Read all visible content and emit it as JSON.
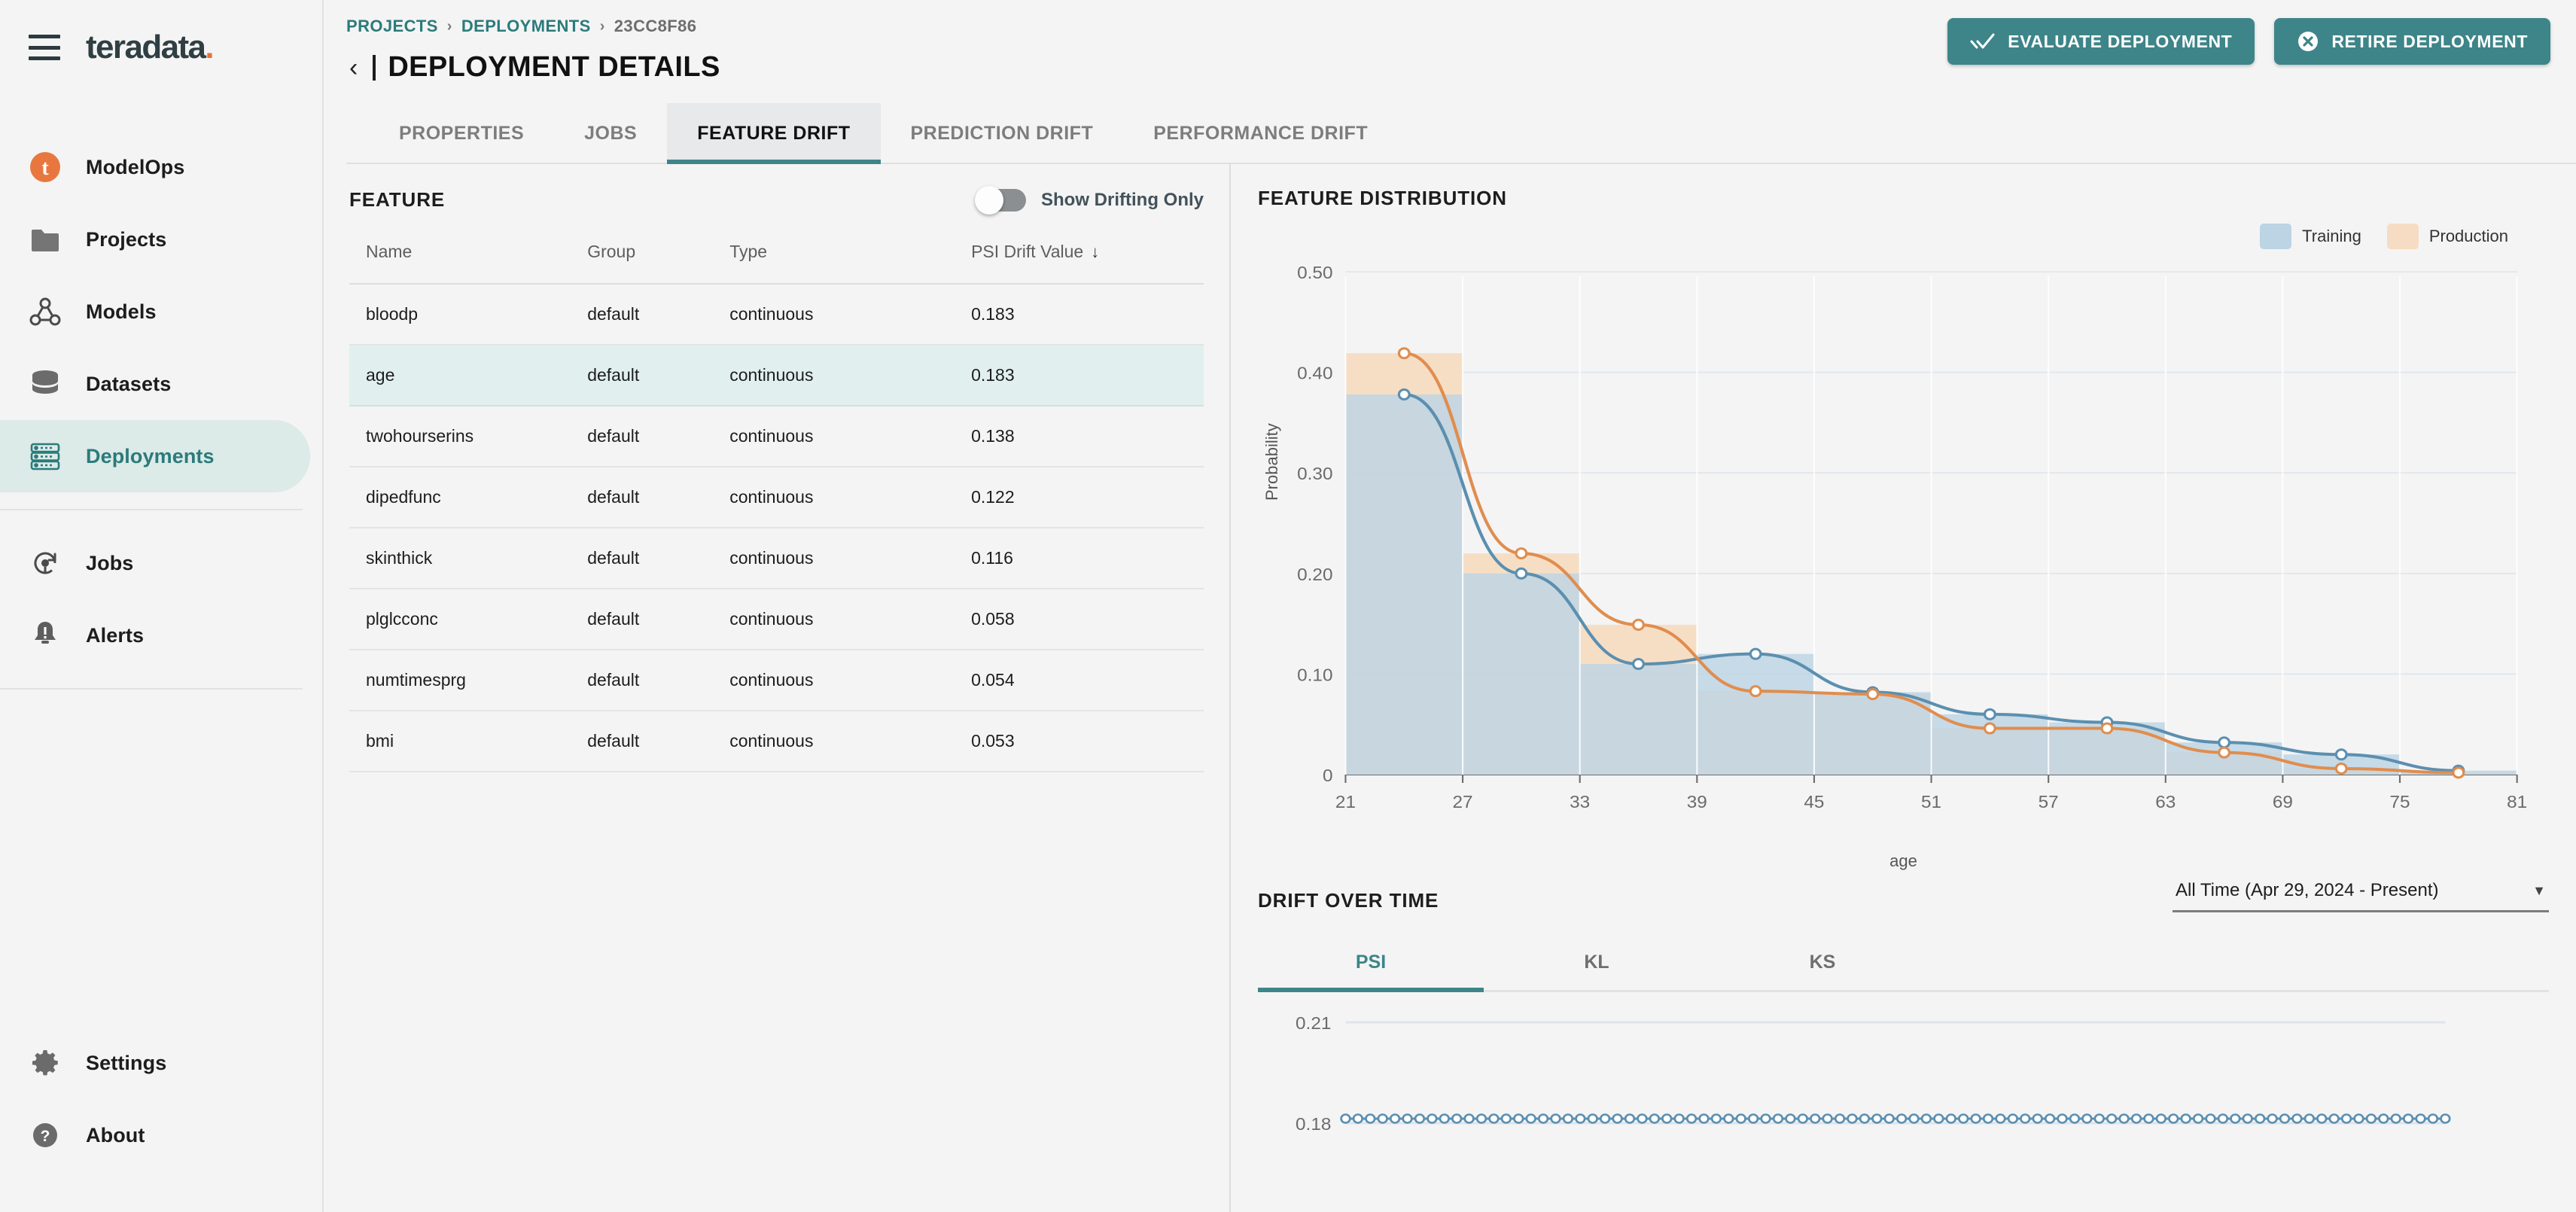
{
  "brand": {
    "name": "teradata",
    "dot": "."
  },
  "sidebar": {
    "items": [
      {
        "label": "ModelOps",
        "icon": "teradata-logo-icon"
      },
      {
        "label": "Projects",
        "icon": "folder-icon"
      },
      {
        "label": "Models",
        "icon": "model-graph-icon"
      },
      {
        "label": "Datasets",
        "icon": "database-icon"
      },
      {
        "label": "Deployments",
        "icon": "server-rack-icon"
      },
      {
        "label": "Jobs",
        "icon": "job-refresh-icon"
      },
      {
        "label": "Alerts",
        "icon": "bell-alert-icon"
      }
    ],
    "bottom_items": [
      {
        "label": "Settings",
        "icon": "gear-icon"
      },
      {
        "label": "About",
        "icon": "question-circle-icon"
      }
    ],
    "active": "Deployments"
  },
  "breadcrumb": {
    "projects": "PROJECTS",
    "deployments": "DEPLOYMENTS",
    "current": "23CC8F86",
    "sep": "›"
  },
  "header": {
    "title": "DEPLOYMENT DETAILS",
    "back_icon": "chevron-left-icon",
    "evaluate_label": "EVALUATE DEPLOYMENT",
    "retire_label": "RETIRE DEPLOYMENT",
    "accent": "#3d8589"
  },
  "tabs": [
    {
      "label": "PROPERTIES",
      "active": false
    },
    {
      "label": "JOBS",
      "active": false
    },
    {
      "label": "FEATURE DRIFT",
      "active": true
    },
    {
      "label": "PREDICTION DRIFT",
      "active": false
    },
    {
      "label": "PERFORMANCE DRIFT",
      "active": false
    }
  ],
  "feature_panel": {
    "title": "FEATURE",
    "toggle_label": "Show Drifting Only",
    "toggle_on": false,
    "columns": [
      "Name",
      "Group",
      "Type",
      "PSI Drift Value"
    ],
    "sort_icon": "↓",
    "sort_column": "PSI Drift Value",
    "selected_row": "age",
    "rows": [
      {
        "name": "bloodp",
        "group": "default",
        "type": "continuous",
        "psi": "0.183"
      },
      {
        "name": "age",
        "group": "default",
        "type": "continuous",
        "psi": "0.183"
      },
      {
        "name": "twohourserins",
        "group": "default",
        "type": "continuous",
        "psi": "0.138"
      },
      {
        "name": "dipedfunc",
        "group": "default",
        "type": "continuous",
        "psi": "0.122"
      },
      {
        "name": "skinthick",
        "group": "default",
        "type": "continuous",
        "psi": "0.116"
      },
      {
        "name": "plglcconc",
        "group": "default",
        "type": "continuous",
        "psi": "0.058"
      },
      {
        "name": "numtimesprg",
        "group": "default",
        "type": "continuous",
        "psi": "0.054"
      },
      {
        "name": "bmi",
        "group": "default",
        "type": "continuous",
        "psi": "0.053"
      }
    ]
  },
  "distribution": {
    "title": "FEATURE DISTRIBUTION",
    "legend": [
      {
        "name": "Training",
        "color": "#bcd4e4"
      },
      {
        "name": "Production",
        "color": "#f6dcc2"
      }
    ]
  },
  "drift_over_time": {
    "title": "DRIFT OVER TIME",
    "range_value": "All Time (Apr 29, 2024 - Present)",
    "caret_icon": "chevron-down-icon",
    "tabs": [
      {
        "label": "PSI",
        "active": true
      },
      {
        "label": "KL",
        "active": false
      },
      {
        "label": "KS",
        "active": false
      }
    ]
  },
  "chart_data": [
    {
      "type": "bar",
      "title": "FEATURE DISTRIBUTION",
      "xlabel": "age",
      "ylabel": "Probability",
      "ylim": [
        0,
        0.5
      ],
      "yticks": [
        0,
        0.1,
        0.2,
        0.3,
        0.4,
        0.5
      ],
      "ytick_labels": [
        "0",
        "0.10",
        "0.20",
        "0.30",
        "0.40",
        "0.50"
      ],
      "xlim": [
        21,
        81
      ],
      "xticks": [
        21,
        27,
        33,
        39,
        45,
        51,
        57,
        63,
        69,
        75,
        81
      ],
      "bin_centers": [
        24,
        30,
        36,
        42,
        48,
        54,
        60,
        66,
        72,
        78
      ],
      "grid": true,
      "legend_position": "top-right",
      "series": [
        {
          "name": "Training",
          "color": "#bcd4e4",
          "line_color": "#5b8fb0",
          "values": [
            0.378,
            0.2,
            0.11,
            0.12,
            0.082,
            0.06,
            0.052,
            0.032,
            0.02,
            0.004
          ]
        },
        {
          "name": "Production",
          "color": "#f6dcc2",
          "line_color": "#e08d4e",
          "values": [
            0.419,
            0.22,
            0.149,
            0.083,
            0.08,
            0.046,
            0.046,
            0.022,
            0.006,
            0.002
          ]
        }
      ]
    },
    {
      "type": "line",
      "title": "DRIFT OVER TIME",
      "metric": "PSI",
      "ylim": [
        0.18,
        0.21
      ],
      "yticks": [
        0.18,
        0.21
      ],
      "ytick_labels": [
        "0.21",
        "0.18"
      ],
      "grid": true,
      "series": [
        {
          "name": "PSI",
          "color": "#5b8fb0",
          "constant_value": 0.183,
          "n_points": 90
        }
      ]
    }
  ]
}
